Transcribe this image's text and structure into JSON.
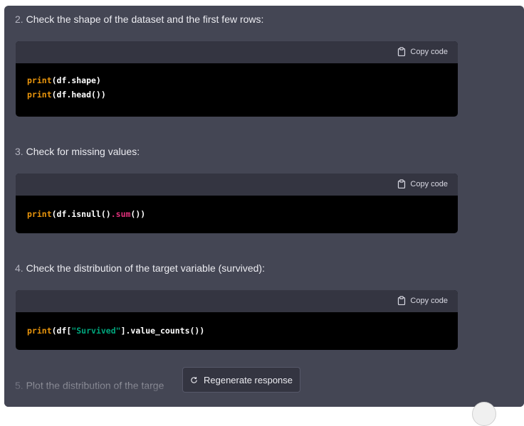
{
  "steps": [
    {
      "num": "2.",
      "text": "Check the shape of the dataset and the first few rows:",
      "copy_label": "Copy code",
      "code_lines": [
        [
          {
            "t": "print",
            "c": "kw"
          },
          {
            "t": "(df.shape)",
            "c": ""
          }
        ],
        [
          {
            "t": "print",
            "c": "kw"
          },
          {
            "t": "(df.head())",
            "c": ""
          }
        ]
      ]
    },
    {
      "num": "3.",
      "text": "Check for missing values:",
      "copy_label": "Copy code",
      "code_lines": [
        [
          {
            "t": "print",
            "c": "kw"
          },
          {
            "t": "(df.isnull()",
            "c": ""
          },
          {
            "t": ".sum",
            "c": "fn"
          },
          {
            "t": "())",
            "c": ""
          }
        ]
      ]
    },
    {
      "num": "4.",
      "text": "Check the distribution of the target variable (survived):",
      "copy_label": "Copy code",
      "code_lines": [
        [
          {
            "t": "print",
            "c": "kw"
          },
          {
            "t": "(df[",
            "c": ""
          },
          {
            "t": "\"Survived\"",
            "c": "str"
          },
          {
            "t": "].value_counts())",
            "c": ""
          }
        ]
      ]
    }
  ],
  "partial_step": {
    "num": "5.",
    "text": "Plot the distribution of the targe"
  },
  "regenerate": {
    "label": "Regenerate response"
  },
  "colors": {
    "panel": "#444654",
    "code_header": "#343541",
    "keyword": "#e9950c",
    "function": "#df3079",
    "string": "#00a67d"
  },
  "icons": {
    "copy": "clipboard-icon",
    "regenerate": "refresh-icon"
  }
}
